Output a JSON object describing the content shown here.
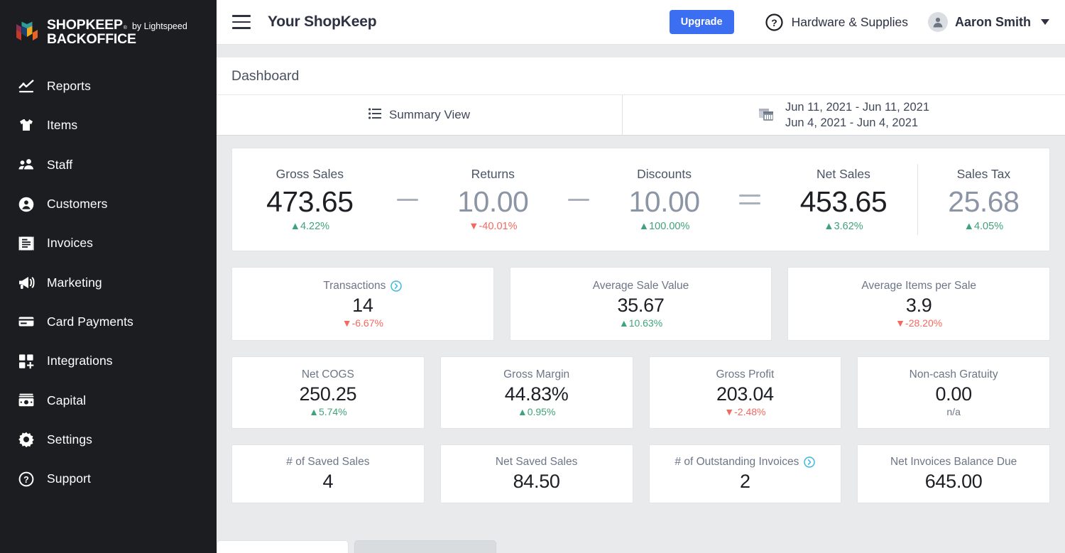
{
  "brand": {
    "name_line1": "SHOPKEEP",
    "registered_mark": "®",
    "by_text": "by Lightspeed",
    "name_line2": "BACKOFFICE",
    "logo_colors": [
      "#2f9c9b",
      "#1c3f6e",
      "#8c2f52",
      "#f0a81e",
      "#c0392b",
      "#e8632a"
    ]
  },
  "sidebar": {
    "items": [
      {
        "label": "Reports",
        "icon": "chart-line-icon"
      },
      {
        "label": "Items",
        "icon": "tshirt-icon"
      },
      {
        "label": "Staff",
        "icon": "people-icon"
      },
      {
        "label": "Customers",
        "icon": "user-circle-icon"
      },
      {
        "label": "Invoices",
        "icon": "invoice-icon"
      },
      {
        "label": "Marketing",
        "icon": "megaphone-icon"
      },
      {
        "label": "Card Payments",
        "icon": "credit-card-icon"
      },
      {
        "label": "Integrations",
        "icon": "grid-plus-icon"
      },
      {
        "label": "Capital",
        "icon": "cash-icon"
      },
      {
        "label": "Settings",
        "icon": "gear-icon"
      },
      {
        "label": "Support",
        "icon": "question-circle-icon"
      }
    ]
  },
  "topbar": {
    "menu_icon": "hamburger-icon",
    "shop_title": "Your ShopKeep",
    "upgrade_label": "Upgrade",
    "upgrade_color": "#3b6ef0",
    "help_icon": "question-circle-icon",
    "store_name": "Hardware & Supplies",
    "avatar_icon": "user-avatar-icon",
    "user_name": "Aaron Smith",
    "caret_icon": "chevron-down-icon"
  },
  "page": {
    "title": "Dashboard"
  },
  "viewbar": {
    "view_icon": "list-icon",
    "view_label": "Summary View",
    "calendar_icon": "calendar-icon",
    "date_range_primary": "Jun 11, 2021 - Jun 11, 2021",
    "date_range_compare": "Jun 4, 2021 - Jun 4, 2021"
  },
  "colors": {
    "positive": "#3fa37a",
    "negative": "#f4685e",
    "info": "#3fb8e0",
    "muted": "#8b95a5"
  },
  "summary": {
    "cells": [
      {
        "label": "Gross Sales",
        "value": "473.65",
        "delta": "4.22%",
        "direction": "up",
        "emphasis": "dark"
      },
      {
        "label": "Returns",
        "value": "10.00",
        "delta": "-40.01%",
        "direction": "down",
        "emphasis": "muted"
      },
      {
        "label": "Discounts",
        "value": "10.00",
        "delta": "100.00%",
        "direction": "up",
        "emphasis": "muted"
      },
      {
        "label": "Net Sales",
        "value": "453.65",
        "delta": "3.62%",
        "direction": "up",
        "emphasis": "dark"
      },
      {
        "label": "Sales Tax",
        "value": "25.68",
        "delta": "4.05%",
        "direction": "up",
        "emphasis": "muted"
      }
    ],
    "operators": [
      "−",
      "−",
      "="
    ]
  },
  "cards": {
    "row2": [
      {
        "label": "Transactions",
        "info_icon": "circle-arrow-right-icon",
        "value": "14",
        "delta": "-6.67%",
        "direction": "down"
      },
      {
        "label": "Average Sale Value",
        "info_icon": "",
        "value": "35.67",
        "delta": "10.63%",
        "direction": "up"
      },
      {
        "label": "Average Items per Sale",
        "info_icon": "",
        "value": "3.9",
        "delta": "-28.20%",
        "direction": "down"
      }
    ],
    "row3": [
      {
        "label": "Net COGS",
        "info_icon": "",
        "value": "250.25",
        "delta": "5.74%",
        "direction": "up"
      },
      {
        "label": "Gross Margin",
        "info_icon": "",
        "value": "44.83%",
        "delta": "0.95%",
        "direction": "up"
      },
      {
        "label": "Gross Profit",
        "info_icon": "",
        "value": "203.04",
        "delta": "-2.48%",
        "direction": "down"
      },
      {
        "label": "Non-cash Gratuity",
        "info_icon": "",
        "value": "0.00",
        "delta": "n/a",
        "direction": "none"
      }
    ],
    "row4": [
      {
        "label": "# of Saved Sales",
        "info_icon": "",
        "value": "4",
        "delta": "",
        "direction": "none"
      },
      {
        "label": "Net Saved Sales",
        "info_icon": "",
        "value": "84.50",
        "delta": "",
        "direction": "none"
      },
      {
        "label": "# of Outstanding Invoices",
        "info_icon": "circle-arrow-right-icon",
        "value": "2",
        "delta": "",
        "direction": "none"
      },
      {
        "label": "Net Invoices Balance Due",
        "info_icon": "",
        "value": "645.00",
        "delta": "",
        "direction": "none"
      }
    ]
  }
}
